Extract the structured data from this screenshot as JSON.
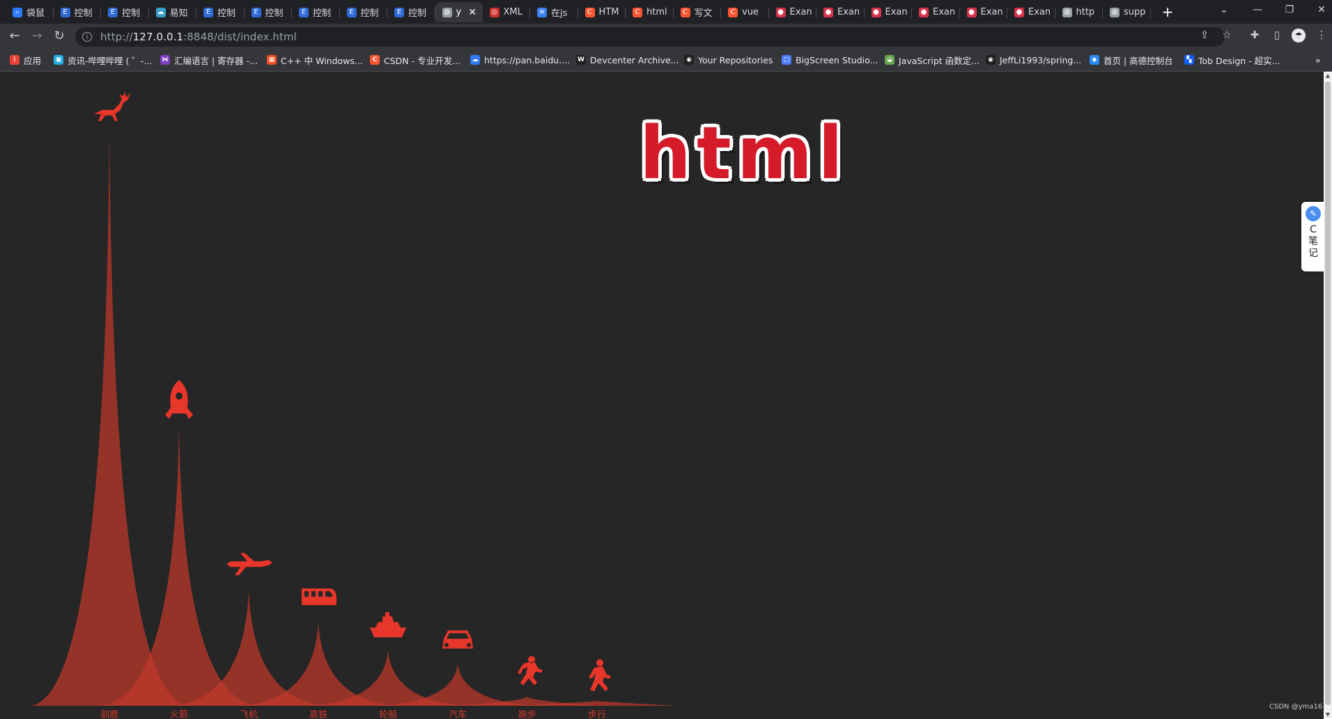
{
  "browser": {
    "tabs": [
      {
        "label": "袋鼠",
        "color": "#2b7cff",
        "glyph": "⌕"
      },
      {
        "label": "控制",
        "color": "#2f6bd6",
        "glyph": "E"
      },
      {
        "label": "控制",
        "color": "#2f6bd6",
        "glyph": "E"
      },
      {
        "label": "易知",
        "color": "#38a0c8",
        "glyph": "☁"
      },
      {
        "label": "控制",
        "color": "#2f6bd6",
        "glyph": "E"
      },
      {
        "label": "控制",
        "color": "#2f6bd6",
        "glyph": "E"
      },
      {
        "label": "控制",
        "color": "#2f6bd6",
        "glyph": "E"
      },
      {
        "label": "控制",
        "color": "#2f6bd6",
        "glyph": "E"
      },
      {
        "label": "控制",
        "color": "#2f6bd6",
        "glyph": "E"
      },
      {
        "label": "y",
        "color": "#9aa0a6",
        "glyph": "◍",
        "active": true
      },
      {
        "label": "XML",
        "color": "#d0312d",
        "glyph": "◎"
      },
      {
        "label": "在js",
        "color": "#3b82f6",
        "glyph": "≋"
      },
      {
        "label": "HTM",
        "color": "#fc5531",
        "glyph": "C"
      },
      {
        "label": "html",
        "color": "#fc5531",
        "glyph": "C"
      },
      {
        "label": "写文",
        "color": "#fc5531",
        "glyph": "C"
      },
      {
        "label": "vue",
        "color": "#fc5531",
        "glyph": "C"
      },
      {
        "label": "Exan",
        "color": "#d8334a",
        "glyph": "●"
      },
      {
        "label": "Exan",
        "color": "#d8334a",
        "glyph": "●"
      },
      {
        "label": "Exan",
        "color": "#d8334a",
        "glyph": "●"
      },
      {
        "label": "Exan",
        "color": "#d8334a",
        "glyph": "●"
      },
      {
        "label": "Exan",
        "color": "#d8334a",
        "glyph": "●"
      },
      {
        "label": "Exan",
        "color": "#d8334a",
        "glyph": "●"
      },
      {
        "label": "http",
        "color": "#9aa0a6",
        "glyph": "◍"
      },
      {
        "label": "supp",
        "color": "#9aa0a6",
        "glyph": "◍"
      }
    ],
    "url_host": "127.0.0.1",
    "url_prefix": "http://",
    "url_rest": ":8848/dist/index.html",
    "bookmarks": [
      {
        "label": "应用",
        "color": "#e94235",
        "glyph": "⋮"
      },
      {
        "label": "资讯-哔哩哔哩 ( ゜-...",
        "color": "#23ade5",
        "glyph": "▣"
      },
      {
        "label": "汇编语言 | 寄存器 -...",
        "color": "#7f3fbf",
        "glyph": "⋈"
      },
      {
        "label": "C++ 中 Windows...",
        "color": "#f25022",
        "glyph": "▦"
      },
      {
        "label": "CSDN - 专业开发...",
        "color": "#fc5531",
        "glyph": "C"
      },
      {
        "label": "https://pan.baidu....",
        "color": "#2f7bf5",
        "glyph": "☁"
      },
      {
        "label": "Devcenter Archive...",
        "color": "#1f1f1f",
        "glyph": "W"
      },
      {
        "label": "Your Repositories",
        "color": "#1f1f1f",
        "glyph": "◉"
      },
      {
        "label": "BigScreen Studio...",
        "color": "#4a7dfc",
        "glyph": "▢"
      },
      {
        "label": "JavaScript 函数定...",
        "color": "#6aa84f",
        "glyph": "◒"
      },
      {
        "label": "JeffLi1993/spring...",
        "color": "#1f1f1f",
        "glyph": "◉"
      },
      {
        "label": "首页 | 高德控制台",
        "color": "#2c8cf4",
        "glyph": "◆"
      },
      {
        "label": "Tob Design - 超实...",
        "color": "#1062fe",
        "glyph": "▚"
      }
    ]
  },
  "page": {
    "logo_text": "html",
    "side_note_text": "C笔记",
    "watermark": "CSDN @yma16"
  },
  "chart_data": {
    "type": "pictorialBar",
    "categories": [
      "驯鹿",
      "火箭",
      "飞机",
      "高铁",
      "轮船",
      "汽车",
      "跑步",
      "步行"
    ],
    "values": [
      123,
      60,
      25,
      18,
      12,
      9,
      2,
      1
    ],
    "ylim": [
      0,
      130
    ],
    "icons": [
      "reindeer-icon",
      "rocket-icon",
      "airplane-icon",
      "train-icon",
      "ship-icon",
      "car-icon",
      "runner-icon",
      "walker-icon"
    ],
    "color": "#c0392b",
    "label_color": "#d43a2f"
  }
}
